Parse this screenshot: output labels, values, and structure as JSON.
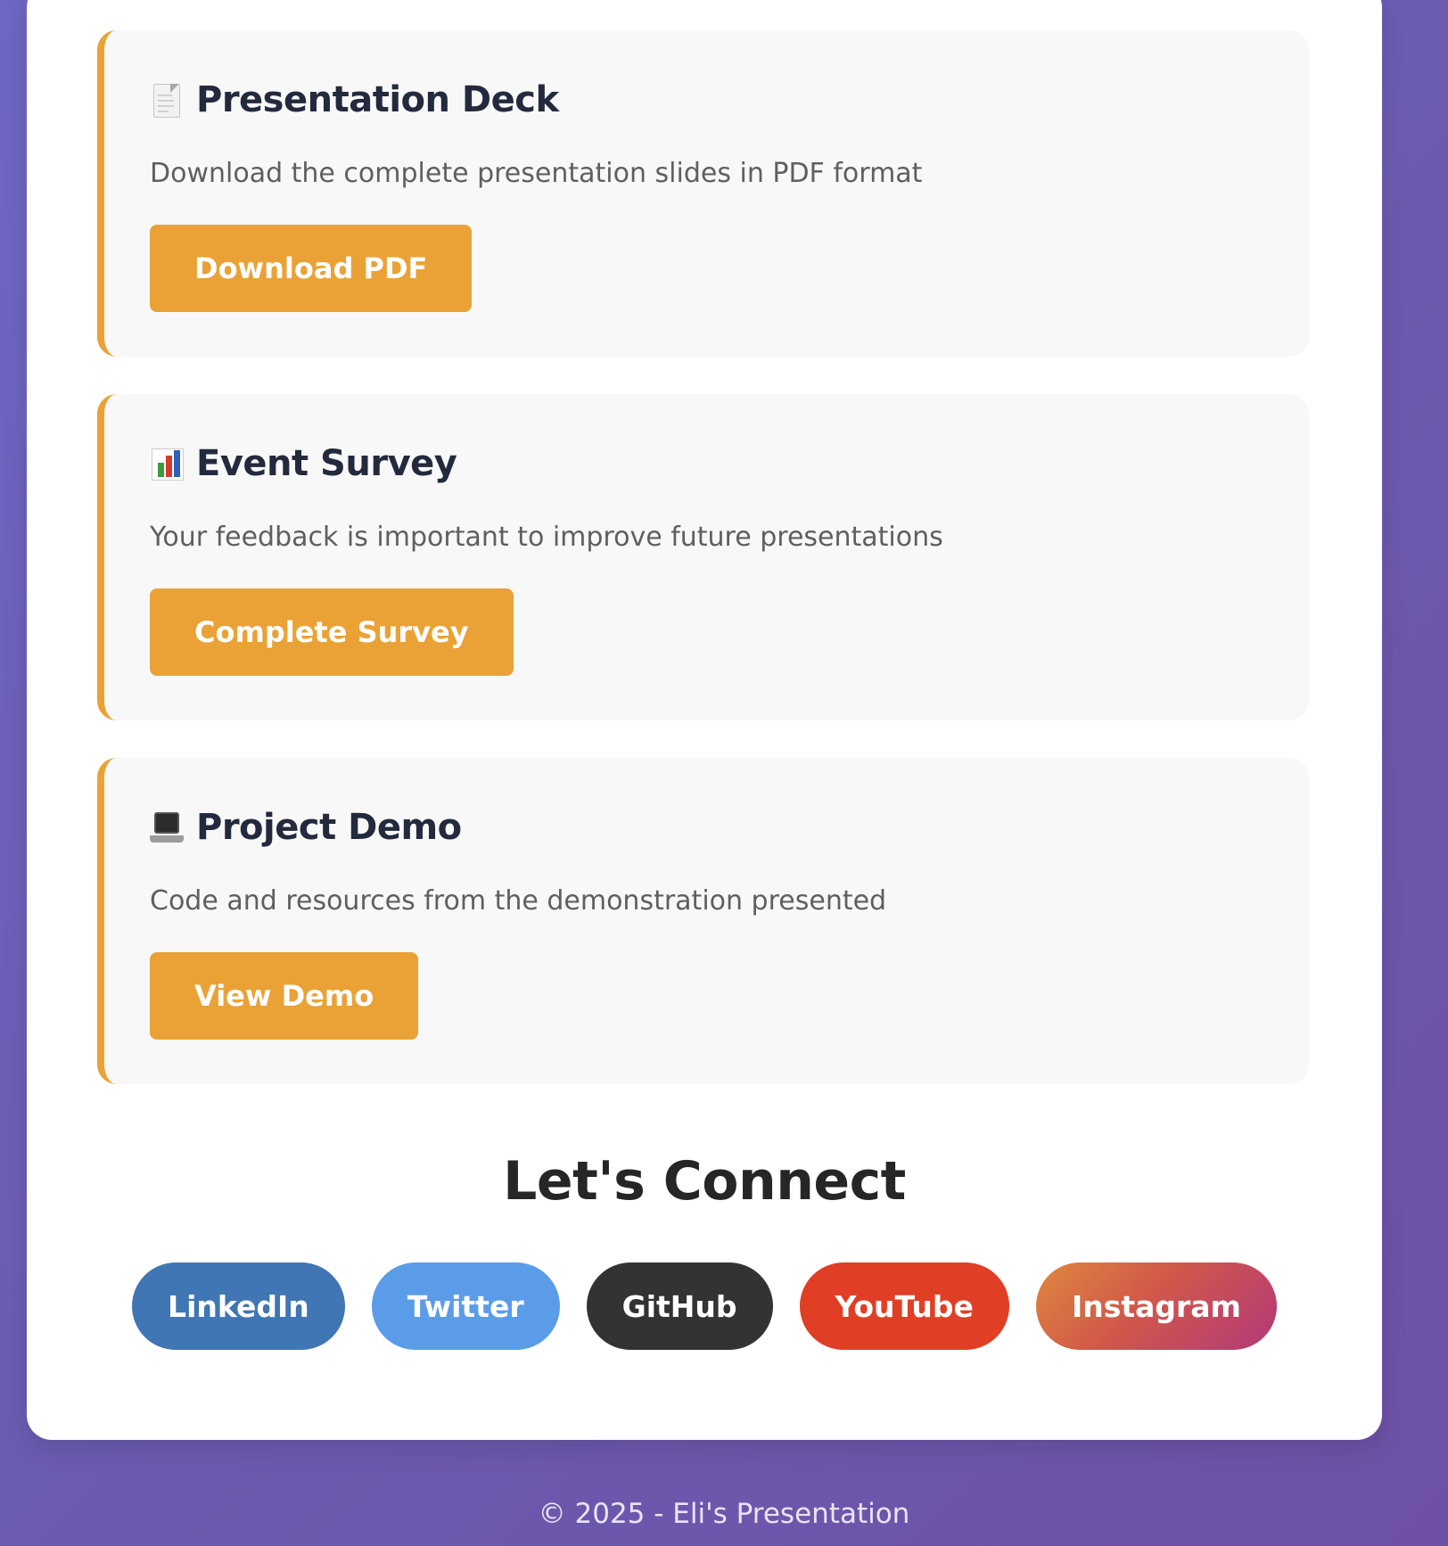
{
  "cards": [
    {
      "icon": "document-icon",
      "title": "Presentation Deck",
      "description": "Download the complete presentation slides in PDF format",
      "button_label": "Download PDF"
    },
    {
      "icon": "bar-chart-icon",
      "title": "Event Survey",
      "description": "Your feedback is important to improve future presentations",
      "button_label": "Complete Survey"
    },
    {
      "icon": "laptop-icon",
      "title": "Project Demo",
      "description": "Code and resources from the demonstration presented",
      "button_label": "View Demo"
    }
  ],
  "connect": {
    "title": "Let's Connect",
    "links": [
      {
        "label": "LinkedIn",
        "color": "#3f76b3"
      },
      {
        "label": "Twitter",
        "color": "#5a9ce8"
      },
      {
        "label": "GitHub",
        "color": "#333333"
      },
      {
        "label": "YouTube",
        "color": "#e03f25"
      },
      {
        "label": "Instagram",
        "color": "gradient #e0873f to #b3387a"
      }
    ]
  },
  "footer": {
    "text": "© 2025 - Eli's Presentation"
  },
  "colors": {
    "accent": "#eaa236",
    "card_background": "#f8f8f8",
    "page_background": "#6c5ab0"
  }
}
